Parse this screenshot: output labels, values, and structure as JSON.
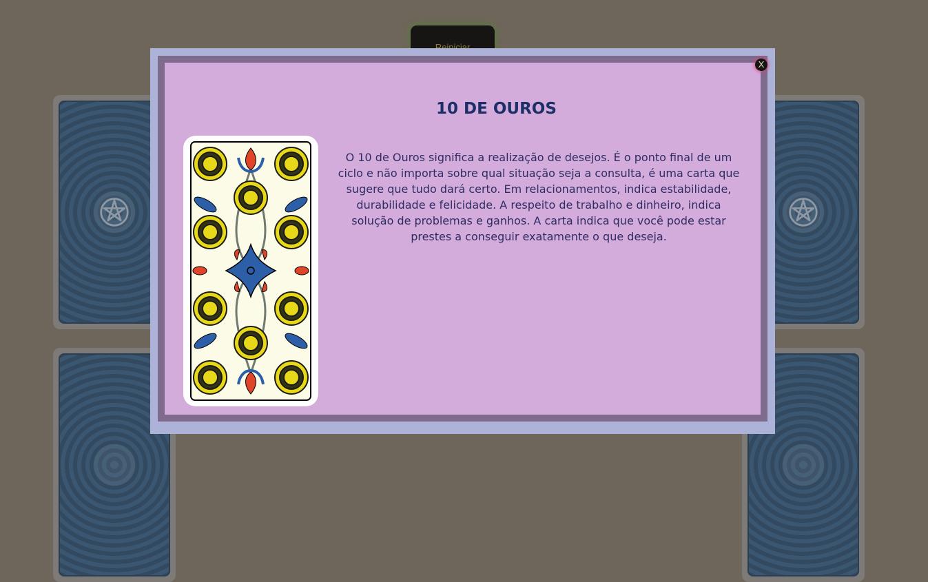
{
  "game": {
    "restart_label": "Reiniciar",
    "card_back_icon": "pentagram-icon"
  },
  "modal": {
    "close_label": "X",
    "title": "10 DE OUROS",
    "card_icon": "ten-of-coins-card",
    "description": "O 10 de Ouros significa a realização de desejos. É o ponto final de um ciclo e não importa sobre qual situação seja a consulta, é uma carta que sugere que tudo dará certo. Em relacionamentos, indica estabilidade, durabilidade e felicidade. A respeito de trabalho e dinheiro, indica solução de problemas e ganhos. A carta indica que você pode estar prestes a conseguir exatamente o que deseja."
  },
  "colors": {
    "background": "#6e665a",
    "modal_border": "#adb2d9",
    "modal_frame": "#7f6b8d",
    "modal_panel": "#d3acdc",
    "title": "#1c2f66",
    "text": "#2f2c62"
  }
}
